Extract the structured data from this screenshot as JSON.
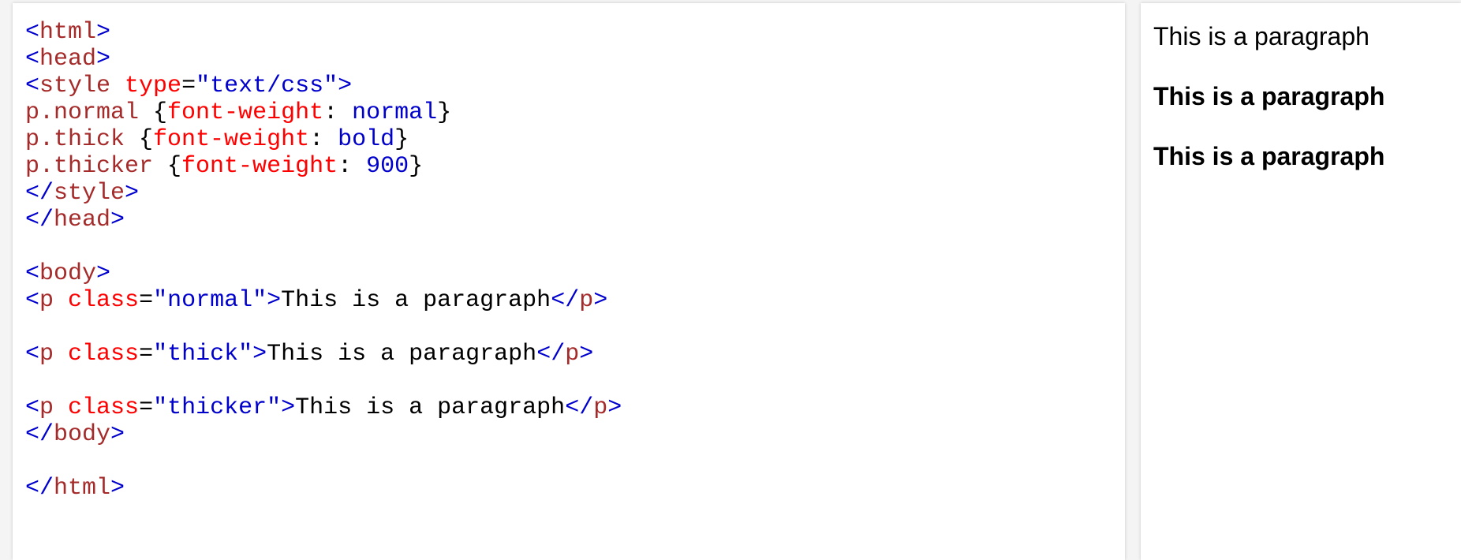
{
  "colors": {
    "bracket": "#0000cd",
    "tag": "#a52a2a",
    "attribute": "#ff0000",
    "value": "#0000cd",
    "text": "#000000"
  },
  "code": {
    "lines": [
      [
        {
          "t": "br",
          "v": "<"
        },
        {
          "t": "tg",
          "v": "html"
        },
        {
          "t": "br",
          "v": ">"
        }
      ],
      [
        {
          "t": "br",
          "v": "<"
        },
        {
          "t": "tg",
          "v": "head"
        },
        {
          "t": "br",
          "v": ">"
        }
      ],
      [
        {
          "t": "br",
          "v": "<"
        },
        {
          "t": "tg",
          "v": "style"
        },
        {
          "t": "pn",
          "v": " "
        },
        {
          "t": "at",
          "v": "type"
        },
        {
          "t": "pn",
          "v": "="
        },
        {
          "t": "vl",
          "v": "\"text/css\""
        },
        {
          "t": "br",
          "v": ">"
        }
      ],
      [
        {
          "t": "sel",
          "v": "p.normal"
        },
        {
          "t": "pn",
          "v": " {"
        },
        {
          "t": "at",
          "v": "font-weight"
        },
        {
          "t": "pn",
          "v": ": "
        },
        {
          "t": "vl",
          "v": "normal"
        },
        {
          "t": "pn",
          "v": "}"
        }
      ],
      [
        {
          "t": "sel",
          "v": "p.thick"
        },
        {
          "t": "pn",
          "v": " {"
        },
        {
          "t": "at",
          "v": "font-weight"
        },
        {
          "t": "pn",
          "v": ": "
        },
        {
          "t": "vl",
          "v": "bold"
        },
        {
          "t": "pn",
          "v": "}"
        }
      ],
      [
        {
          "t": "sel",
          "v": "p.thicker"
        },
        {
          "t": "pn",
          "v": " {"
        },
        {
          "t": "at",
          "v": "font-weight"
        },
        {
          "t": "pn",
          "v": ": "
        },
        {
          "t": "vl",
          "v": "900"
        },
        {
          "t": "pn",
          "v": "}"
        }
      ],
      [
        {
          "t": "br",
          "v": "</"
        },
        {
          "t": "tg",
          "v": "style"
        },
        {
          "t": "br",
          "v": ">"
        }
      ],
      [
        {
          "t": "br",
          "v": "</"
        },
        {
          "t": "tg",
          "v": "head"
        },
        {
          "t": "br",
          "v": ">"
        }
      ],
      [],
      [
        {
          "t": "br",
          "v": "<"
        },
        {
          "t": "tg",
          "v": "body"
        },
        {
          "t": "br",
          "v": ">"
        }
      ],
      [
        {
          "t": "br",
          "v": "<"
        },
        {
          "t": "tg",
          "v": "p"
        },
        {
          "t": "pn",
          "v": " "
        },
        {
          "t": "at",
          "v": "class"
        },
        {
          "t": "pn",
          "v": "="
        },
        {
          "t": "vl",
          "v": "\"normal\""
        },
        {
          "t": "br",
          "v": ">"
        },
        {
          "t": "tx",
          "v": "This is a paragraph"
        },
        {
          "t": "br",
          "v": "</"
        },
        {
          "t": "tg",
          "v": "p"
        },
        {
          "t": "br",
          "v": ">"
        }
      ],
      [],
      [
        {
          "t": "br",
          "v": "<"
        },
        {
          "t": "tg",
          "v": "p"
        },
        {
          "t": "pn",
          "v": " "
        },
        {
          "t": "at",
          "v": "class"
        },
        {
          "t": "pn",
          "v": "="
        },
        {
          "t": "vl",
          "v": "\"thick\""
        },
        {
          "t": "br",
          "v": ">"
        },
        {
          "t": "tx",
          "v": "This is a paragraph"
        },
        {
          "t": "br",
          "v": "</"
        },
        {
          "t": "tg",
          "v": "p"
        },
        {
          "t": "br",
          "v": ">"
        }
      ],
      [],
      [
        {
          "t": "br",
          "v": "<"
        },
        {
          "t": "tg",
          "v": "p"
        },
        {
          "t": "pn",
          "v": " "
        },
        {
          "t": "at",
          "v": "class"
        },
        {
          "t": "pn",
          "v": "="
        },
        {
          "t": "vl",
          "v": "\"thicker\""
        },
        {
          "t": "br",
          "v": ">"
        },
        {
          "t": "tx",
          "v": "This is a paragraph"
        },
        {
          "t": "br",
          "v": "</"
        },
        {
          "t": "tg",
          "v": "p"
        },
        {
          "t": "br",
          "v": ">"
        }
      ],
      [
        {
          "t": "br",
          "v": "</"
        },
        {
          "t": "tg",
          "v": "body"
        },
        {
          "t": "br",
          "v": ">"
        }
      ],
      [],
      [
        {
          "t": "br",
          "v": "</"
        },
        {
          "t": "tg",
          "v": "html"
        },
        {
          "t": "br",
          "v": ">"
        }
      ]
    ]
  },
  "result": {
    "paragraphs": [
      {
        "class": "normal",
        "text": "This is a paragraph"
      },
      {
        "class": "thick",
        "text": "This is a paragraph"
      },
      {
        "class": "thicker",
        "text": "This is a paragraph"
      }
    ]
  }
}
